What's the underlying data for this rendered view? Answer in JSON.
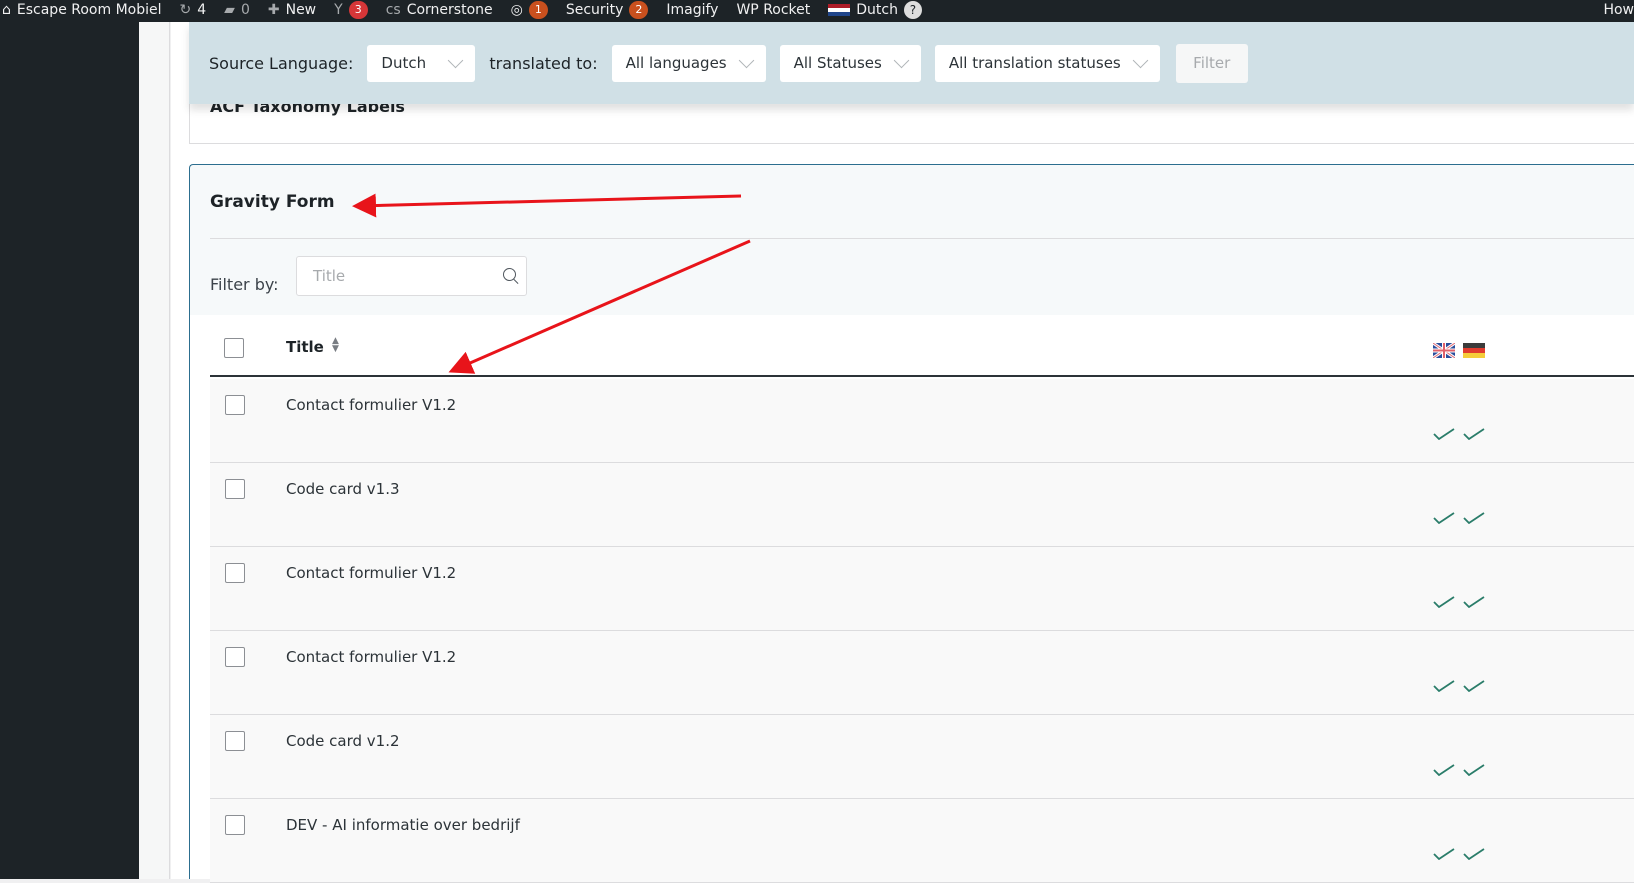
{
  "adminbar": {
    "site": "Escape Room Mobiel",
    "updates": "4",
    "comments": "0",
    "new": "New",
    "yoast_count": "3",
    "cornerstone": "Cornerstone",
    "notif_count": "1",
    "security": "Security",
    "security_count": "2",
    "imagify": "Imagify",
    "wp_rocket": "WP Rocket",
    "language": "Dutch",
    "help": "?",
    "howdy": "How"
  },
  "filterbar": {
    "source_label": "Source Language:",
    "source_value": "Dutch",
    "translated_label": "translated to:",
    "languages": "All languages",
    "statuses": "All Statuses",
    "translation_statuses": "All translation statuses",
    "filter": "Filter"
  },
  "acf_section": {
    "title": "ACF Taxonomy Labels"
  },
  "gravity": {
    "title": "Gravity Form",
    "filter_label": "Filter by:",
    "search_placeholder": "Title",
    "column_title": "Title",
    "languages": [
      "English",
      "German"
    ],
    "rows": [
      {
        "title": "Contact formulier V1.2"
      },
      {
        "title": "Code card v1.3"
      },
      {
        "title": "Contact formulier V1.2"
      },
      {
        "title": "Contact formulier V1.2"
      },
      {
        "title": "Code card v1.2"
      },
      {
        "title": "DEV - AI informatie over bedrijf"
      }
    ]
  },
  "colors": {
    "check": "#2a7d6a",
    "accent_border": "#2c6e8f",
    "arrow": "#e8141a"
  }
}
